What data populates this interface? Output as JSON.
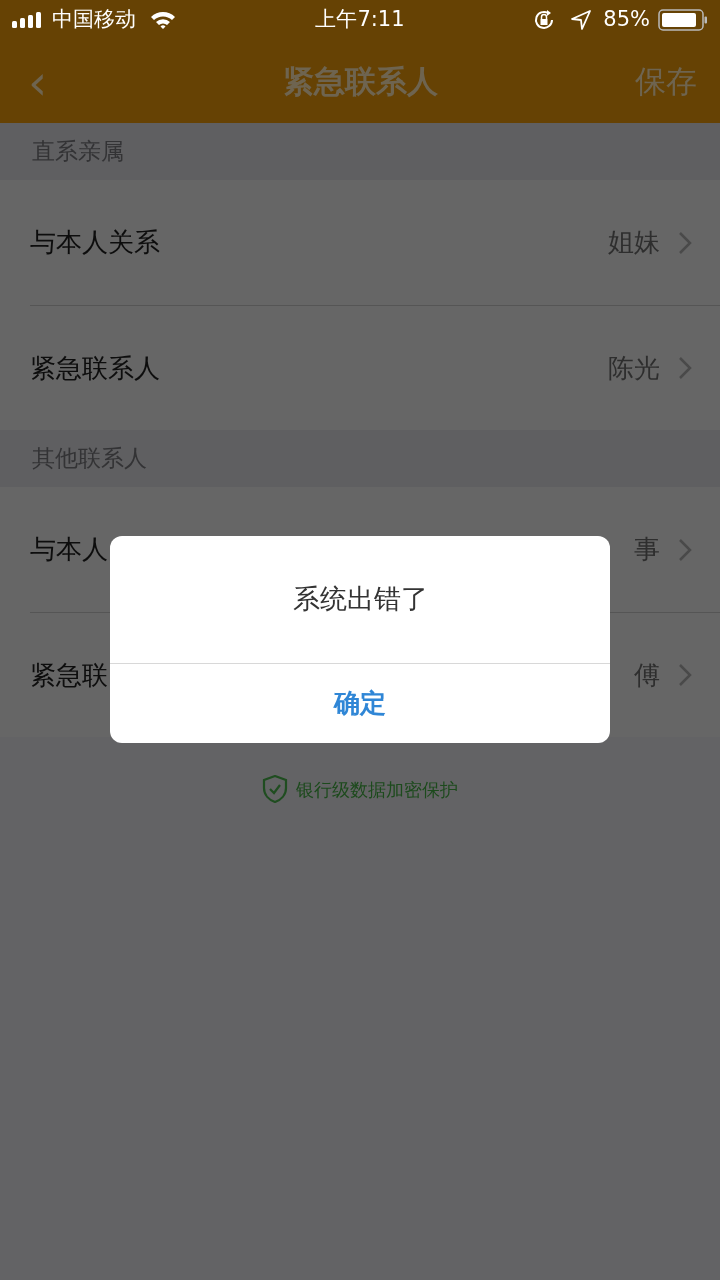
{
  "status_bar": {
    "carrier": "中国移动",
    "time": "上午7:11",
    "battery": "85%"
  },
  "nav_bar": {
    "back": "‹",
    "title": "紧急联系人",
    "action": "保存"
  },
  "sections": [
    {
      "header": "直系亲属",
      "rows": [
        {
          "label": "与本人关系",
          "value": "姐妹"
        },
        {
          "label": "紧急联系人",
          "value": "陈光"
        }
      ]
    },
    {
      "header": "其他联系人",
      "rows": [
        {
          "label": "与本人",
          "value": "事"
        },
        {
          "label": "紧急联",
          "value": "傅"
        }
      ]
    }
  ],
  "footer": "银行级数据加密保护",
  "dialog": {
    "message": "系统出错了",
    "button": "确定"
  }
}
